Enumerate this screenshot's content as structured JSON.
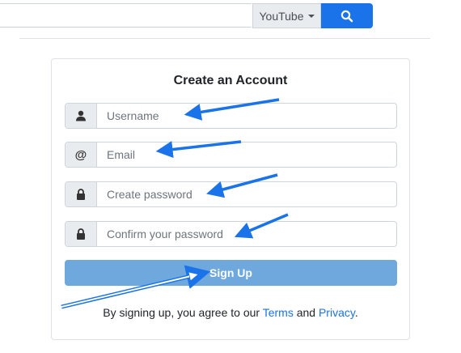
{
  "search": {
    "query": "",
    "source_label": "YouTube",
    "search_icon": "magnifier-icon"
  },
  "signup_card": {
    "title": "Create an Account",
    "fields": [
      {
        "icon": "user-icon",
        "placeholder": "Username"
      },
      {
        "icon": "at-icon",
        "icon_text": "@",
        "placeholder": "Email"
      },
      {
        "icon": "lock-icon",
        "placeholder": "Create password"
      },
      {
        "icon": "lock-icon",
        "placeholder": "Confirm your password"
      }
    ],
    "submit_label": "Sign Up",
    "terms": {
      "prefix": "By signing up, you agree to our ",
      "terms_link": "Terms",
      "middle": " and ",
      "privacy_link": "Privacy",
      "suffix": "."
    }
  },
  "colors": {
    "primary": "#1a73e8",
    "submit_disabled": "#6ea8dc",
    "addon_bg": "#e9ecef",
    "annotation_arrow": "#1a73e8"
  }
}
